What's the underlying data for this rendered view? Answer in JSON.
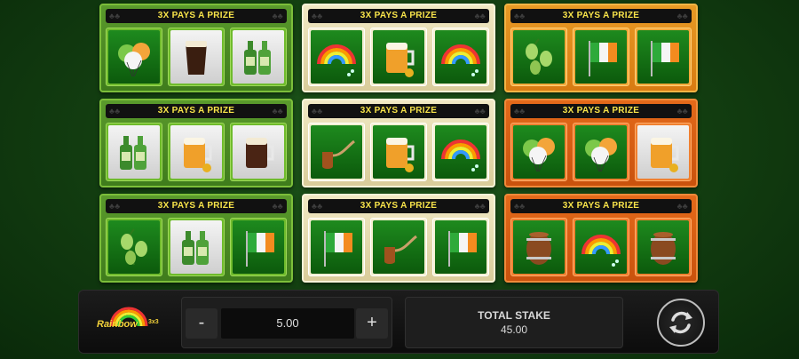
{
  "cards": [
    {
      "theme": "green",
      "banner": "3X PAYS A PRIZE",
      "symbols": [
        "balloons-icon",
        "stout-pint-icon",
        "beer-bottles-icon"
      ]
    },
    {
      "theme": "cream",
      "banner": "3X PAYS A PRIZE",
      "symbols": [
        "rainbow-icon",
        "beer-mug-icon",
        "rainbow-icon"
      ]
    },
    {
      "theme": "orange",
      "banner": "3X PAYS A PRIZE",
      "symbols": [
        "hops-icon",
        "irish-flag-icon",
        "irish-flag-icon"
      ]
    },
    {
      "theme": "green",
      "banner": "3X PAYS A PRIZE",
      "symbols": [
        "beer-bottles-icon",
        "beer-mug-icon",
        "stout-mug-icon"
      ]
    },
    {
      "theme": "cream",
      "banner": "3X PAYS A PRIZE",
      "symbols": [
        "pipe-icon",
        "beer-mug-icon",
        "rainbow-icon"
      ]
    },
    {
      "theme": "orange2",
      "banner": "3X PAYS A PRIZE",
      "symbols": [
        "balloons-icon",
        "balloons-icon",
        "beer-mug-icon"
      ]
    },
    {
      "theme": "green",
      "banner": "3X PAYS A PRIZE",
      "symbols": [
        "hops-icon",
        "beer-bottles-icon",
        "irish-flag-icon"
      ]
    },
    {
      "theme": "cream",
      "banner": "3X PAYS A PRIZE",
      "symbols": [
        "irish-flag-icon",
        "pipe-icon",
        "irish-flag-icon"
      ]
    },
    {
      "theme": "orange2",
      "banner": "3X PAYS A PRIZE",
      "symbols": [
        "barrel-icon",
        "rainbow-icon",
        "barrel-icon"
      ]
    }
  ],
  "controls": {
    "logo_text": "Rainbow",
    "logo_sup": "3x3",
    "minus_label": "-",
    "plus_label": "+",
    "stake_value": "5.00",
    "total_label": "TOTAL STAKE",
    "total_value": "45.00",
    "spin_icon": "refresh-icon"
  },
  "colors": {
    "banner_text": "#f7e34a",
    "background": "#123d10"
  }
}
